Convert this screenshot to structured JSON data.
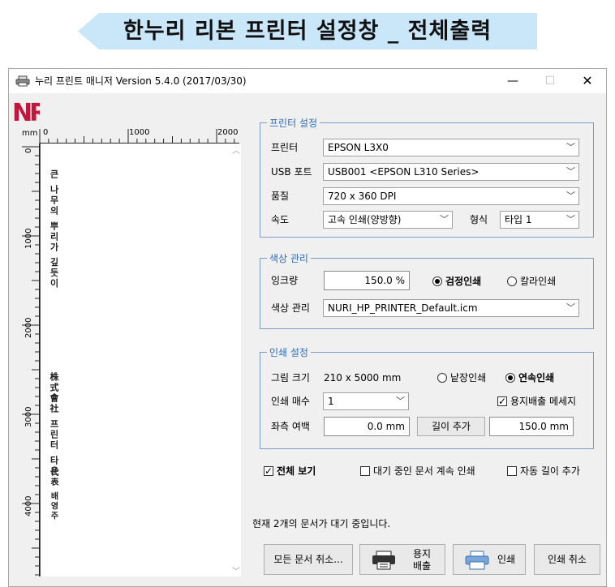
{
  "banner": {
    "title": "한누리 리본 프린터 설정창 _ 전체출력",
    "color": "#c9e7f8"
  },
  "window": {
    "title": "누리 프린트 매니저 Version 5.4.0 (2017/03/30)",
    "min": "—",
    "max": "☐",
    "close": "✕"
  },
  "logo": {
    "text": "NR",
    "color": "#c0183c"
  },
  "ruler": {
    "unit": "mm",
    "top_labels": [
      "0",
      "1000",
      "2000"
    ],
    "left_labels": [
      "0",
      "1000",
      "2000",
      "3000",
      "4000"
    ]
  },
  "preview": {
    "text1": "큰 나무의 뿌리가 깊듯이",
    "text2": "株式會社 프린터 타운",
    "text3": "代表 배영주"
  },
  "printer_group": {
    "title": "프린터 설정",
    "printer_label": "프린터",
    "printer_value": "EPSON L3X0",
    "usb_label": "USB 포트",
    "usb_value": "USB001  <EPSON L310 Series>",
    "quality_label": "품질",
    "quality_value": "720 x 360 DPI",
    "speed_label": "속도",
    "speed_value": "고속 인쇄(양방향)",
    "type_label": "형식",
    "type_value": "타입 1"
  },
  "color_group": {
    "title": "색상 관리",
    "ink_label": "잉크량",
    "ink_value": "150.0 %",
    "black_label": "검정인쇄",
    "color_label": "칼라인쇄",
    "profile_label": "색상 관리",
    "profile_value": "NURI_HP_PRINTER_Default.icm"
  },
  "print_group": {
    "title": "인쇄 설정",
    "size_label": "그림 크기",
    "size_value": "210 x 5000 mm",
    "single_label": "낱장인쇄",
    "continuous_label": "연속인쇄",
    "copies_label": "인쇄 매수",
    "copies_value": "1",
    "eject_msg_label": "용지배출 메세지",
    "margin_label": "좌측 여백",
    "margin_value": "0.0 mm",
    "add_length_label": "길이 추가",
    "add_length_value": "150.0 mm"
  },
  "options": {
    "full_view": "전체 보기",
    "continue_waiting": "대기 중인 문서 계속 인쇄",
    "auto_length": "자동 길이 추가"
  },
  "status": "현재 2개의 문서가 대기 중입니다.",
  "buttons": {
    "cancel_all": "모든 문서 취소...",
    "eject_line1": "용지",
    "eject_line2": "배출",
    "print": "인쇄",
    "cancel_print": "인쇄 취소"
  },
  "icons": [
    "printer-icon",
    "eject-icon",
    "print-icon"
  ]
}
